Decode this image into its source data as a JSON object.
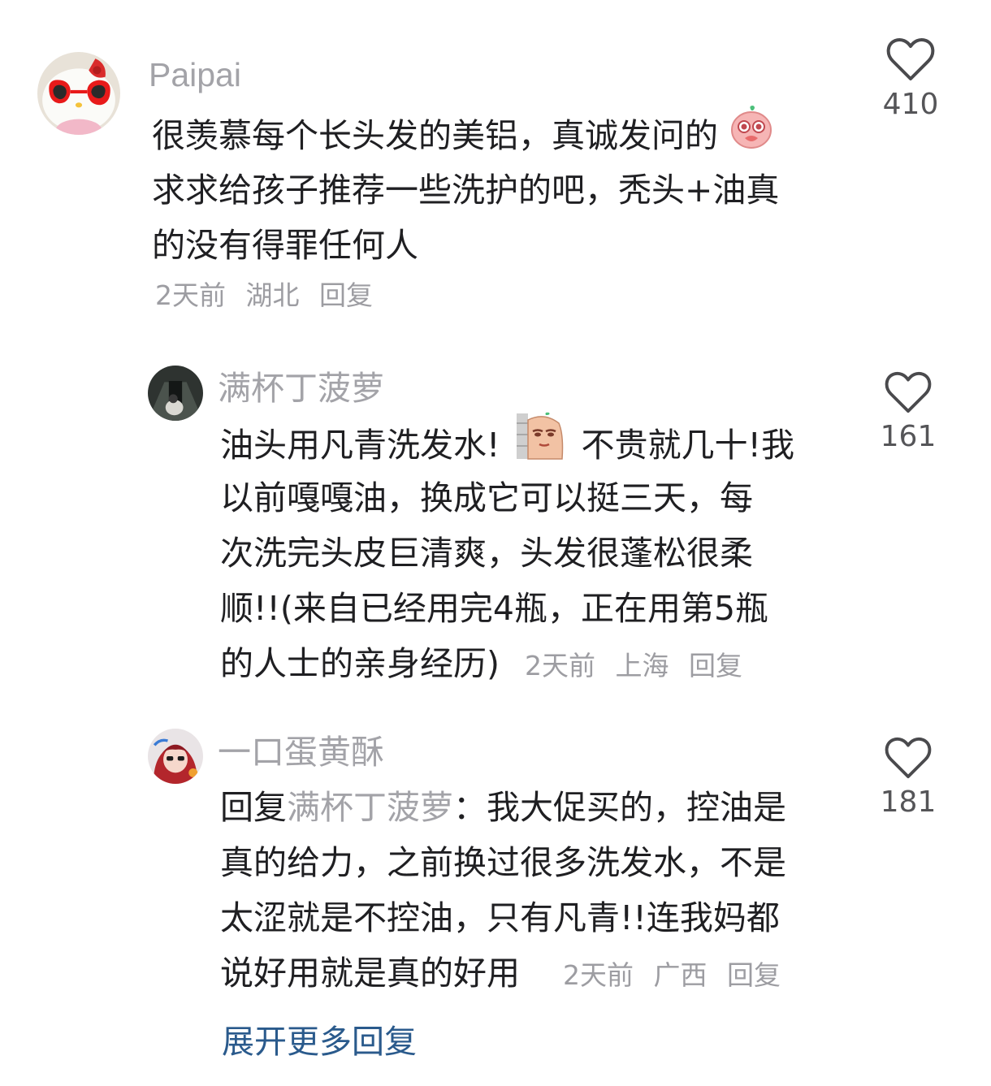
{
  "comments": [
    {
      "username": "Paipai",
      "lines": [
        "很羡慕每个长头发的美铝，真诚发问的",
        "求求给孩子推荐一些洗护的吧，秃头+油真",
        "的没有得罪任何人"
      ],
      "time": "2天前",
      "location": "湖北",
      "reply_label": "回复",
      "likes": "410",
      "avatar_icon": "hello-kitty-sunglasses-avatar",
      "emoji_icon": "pleading-face-emoji"
    },
    {
      "username": "满杯丁菠萝",
      "lines": [
        "油头用凡青洗发水!",
        "不贵就几十!我",
        "以前嘎嘎油，换成它可以挺三天，每",
        "次洗完头皮巨清爽，头发很蓬松很柔",
        "顺!!(来自已经用完4瓶，正在用第5瓶",
        "的人士的亲身经历)"
      ],
      "time": "2天前",
      "location": "上海",
      "reply_label": "回复",
      "likes": "161",
      "avatar_icon": "dark-photo-avatar",
      "emoji_icon": "peeking-wall-emoji"
    },
    {
      "username": "一口蛋黄酥",
      "reply_prefix": "回复",
      "reply_to": "满杯丁菠萝",
      "reply_colon": "：",
      "lines": [
        "我大促买的，控油是",
        "真的给力，之前换过很多洗发水，不是",
        "太涩就是不控油，只有凡青!!连我妈都",
        "说好用就是真的好用"
      ],
      "time": "2天前",
      "location": "广西",
      "reply_label": "回复",
      "likes": "181",
      "avatar_icon": "anime-girl-avatar"
    }
  ],
  "expand_replies_label": "展开更多回复",
  "colors": {
    "username": "#a3a3a8",
    "text": "#1f1f22",
    "meta": "#9d9da2",
    "link": "#2a5a8c"
  }
}
